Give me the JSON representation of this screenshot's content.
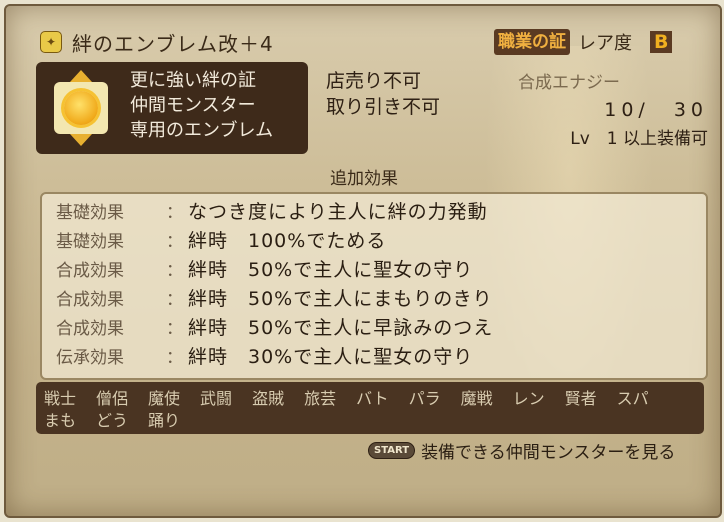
{
  "item": {
    "title": "絆のエンブレム改＋4",
    "title_icon": "emblem-icon",
    "category": "職業の証",
    "rarity_label": "レア度",
    "rarity_value": "B"
  },
  "description": {
    "lines": [
      "更に強い絆の証",
      "仲間モンスター",
      "専用のエンブレム"
    ]
  },
  "trade": {
    "shop": "店売り不可",
    "exchange": "取り引き不可"
  },
  "synthesis": {
    "label": "合成エナジー",
    "value": "10/　30",
    "level": "Lv　1 以上装備可"
  },
  "extra_effects_heading": "追加効果",
  "effects": [
    {
      "category": "基礎効果",
      "colon": "：",
      "text": "なつき度により主人に絆の力発動"
    },
    {
      "category": "基礎効果",
      "colon": "：",
      "text": "絆時　100%でためる"
    },
    {
      "category": "合成効果",
      "colon": "：",
      "text": "絆時　50%で主人に聖女の守り"
    },
    {
      "category": "合成効果",
      "colon": "：",
      "text": "絆時　50%で主人にまもりのきり"
    },
    {
      "category": "合成効果",
      "colon": "：",
      "text": "絆時　50%で主人に早詠みのつえ"
    },
    {
      "category": "伝承効果",
      "colon": "：",
      "text": "絆時　30%で主人に聖女の守り"
    }
  ],
  "jobs": {
    "row1": [
      "戦士",
      "僧侶",
      "魔使",
      "武闘",
      "盗賊",
      "旅芸",
      "バト",
      "パラ",
      "魔戦",
      "レン",
      "賢者",
      "スパ"
    ],
    "row2": [
      "まも",
      "どう",
      "踊り"
    ]
  },
  "start_hint": {
    "button": "START",
    "text": "装備できる仲間モンスターを見る"
  }
}
